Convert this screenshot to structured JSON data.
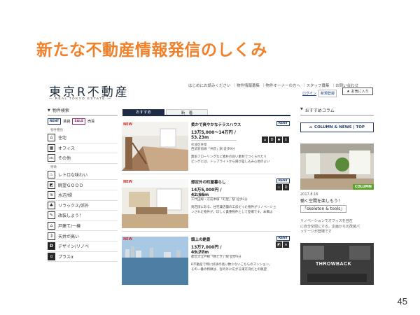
{
  "slide": {
    "title": "新たな不動産情報発信のしくみ",
    "page_number": "45"
  },
  "header": {
    "logo_main": "東京R不動産",
    "logo_sub": "— REAL TOKYO ESTATE —",
    "nav": [
      "はじめにお読みください",
      "｜物件情報募集",
      "｜物件オーナーの方へ",
      "｜スタッフ募集",
      "｜お問い合わせ"
    ],
    "login": "ログイン",
    "register": "新規登録",
    "favorites": "お気に入り",
    "favorites_icon": "star-icon"
  },
  "sidebar": {
    "search_label": "物件検索",
    "chips": {
      "rent": "RENT",
      "rent_text": "賃貸",
      "sale": "SALE",
      "sale_text": "売買"
    },
    "type_heading": "物件種別",
    "types": [
      {
        "label": "住宅",
        "icon": "⌂"
      },
      {
        "label": "オフィス",
        "icon": "▦"
      },
      {
        "label": "その他",
        "icon": "etc"
      }
    ],
    "features_heading": "特徴",
    "features": [
      {
        "label": "レトロな味わい",
        "icon": "♨"
      },
      {
        "label": "眺望ＧＯＯＤ",
        "icon": "◩"
      },
      {
        "label": "水辺/緑",
        "icon": "≋"
      },
      {
        "label": "リラックス/郊外",
        "icon": "♣"
      },
      {
        "label": "改装しよう！",
        "icon": "✎"
      },
      {
        "label": "戸建て/一棟",
        "icon": "⌂"
      },
      {
        "label": "天井が高い",
        "icon": "⇕"
      },
      {
        "label": "デザイン/リノベ",
        "icon": "D"
      },
      {
        "label": "プラスα",
        "icon": "α"
      }
    ]
  },
  "tabs": {
    "recommended": "おすすめ",
    "new": "新　着"
  },
  "listings": [
    {
      "new": "NEW",
      "title": "柔かで爽やかなテラスハウス",
      "badge": "RENT",
      "price": "13万5,000〜14万円 /",
      "area": "53.23m",
      "sub1": "杉並区井草",
      "sub2": "西武新宿線「井荻」駅 徒歩9分",
      "desc1": "無垢フローリングなど素朴の良い素材でつくられたリ",
      "desc2": "ビングには、トップライトから陽が差し込み心地のよい"
    },
    {
      "new": "NEW",
      "title": "想定外の町屋暮らし",
      "badge": "RENT",
      "price": "14万5,000円 / 42.66m",
      "area": "",
      "sub1": "荒川区荒川",
      "sub2": "千代田線・京成本線「町屋」駅 徒歩2分",
      "desc1": "商店街にある、住宅兼店舗の工房だった物件がリノベーショ",
      "desc2": "ンされた物件が。珍しく貴重物件として登場です。本来は"
    },
    {
      "new": "NEW",
      "title": "頭上の絶景",
      "badge": "RENT",
      "price": "13万7,000円 / 49.77m",
      "area": "",
      "sub1": "中央区晴海",
      "sub2": "都営大江戸線「勝どき」駅 徒歩9分",
      "desc1": "R不動産で特に好評の高い数少ないこちらのマンション。",
      "desc2": "その一番の特徴は、窓の外に広がる東京湾だとの眺望"
    }
  ],
  "column": {
    "heading": "おすすめコラム",
    "banner": "COLUMN & NEWS | TOP",
    "banner_icon": "home-icon",
    "badge": "COLUMN",
    "date": "2017.8.16",
    "title1": "働く空間を楽しもう！",
    "title2": "「skeleton & tools」",
    "desc1": "リノベーションでオフィスを自在",
    "desc2": "に自分空間にする。企画からの改装パ",
    "desc3": "ッケージが登場です",
    "throwback": "THROWBACK"
  },
  "colors": {
    "title_orange": "#f0812a",
    "navy": "#1f2a44",
    "rent_blue": "#1f3a6a",
    "sale_purple": "#8a2a6a",
    "column_green": "#5aa52a"
  }
}
